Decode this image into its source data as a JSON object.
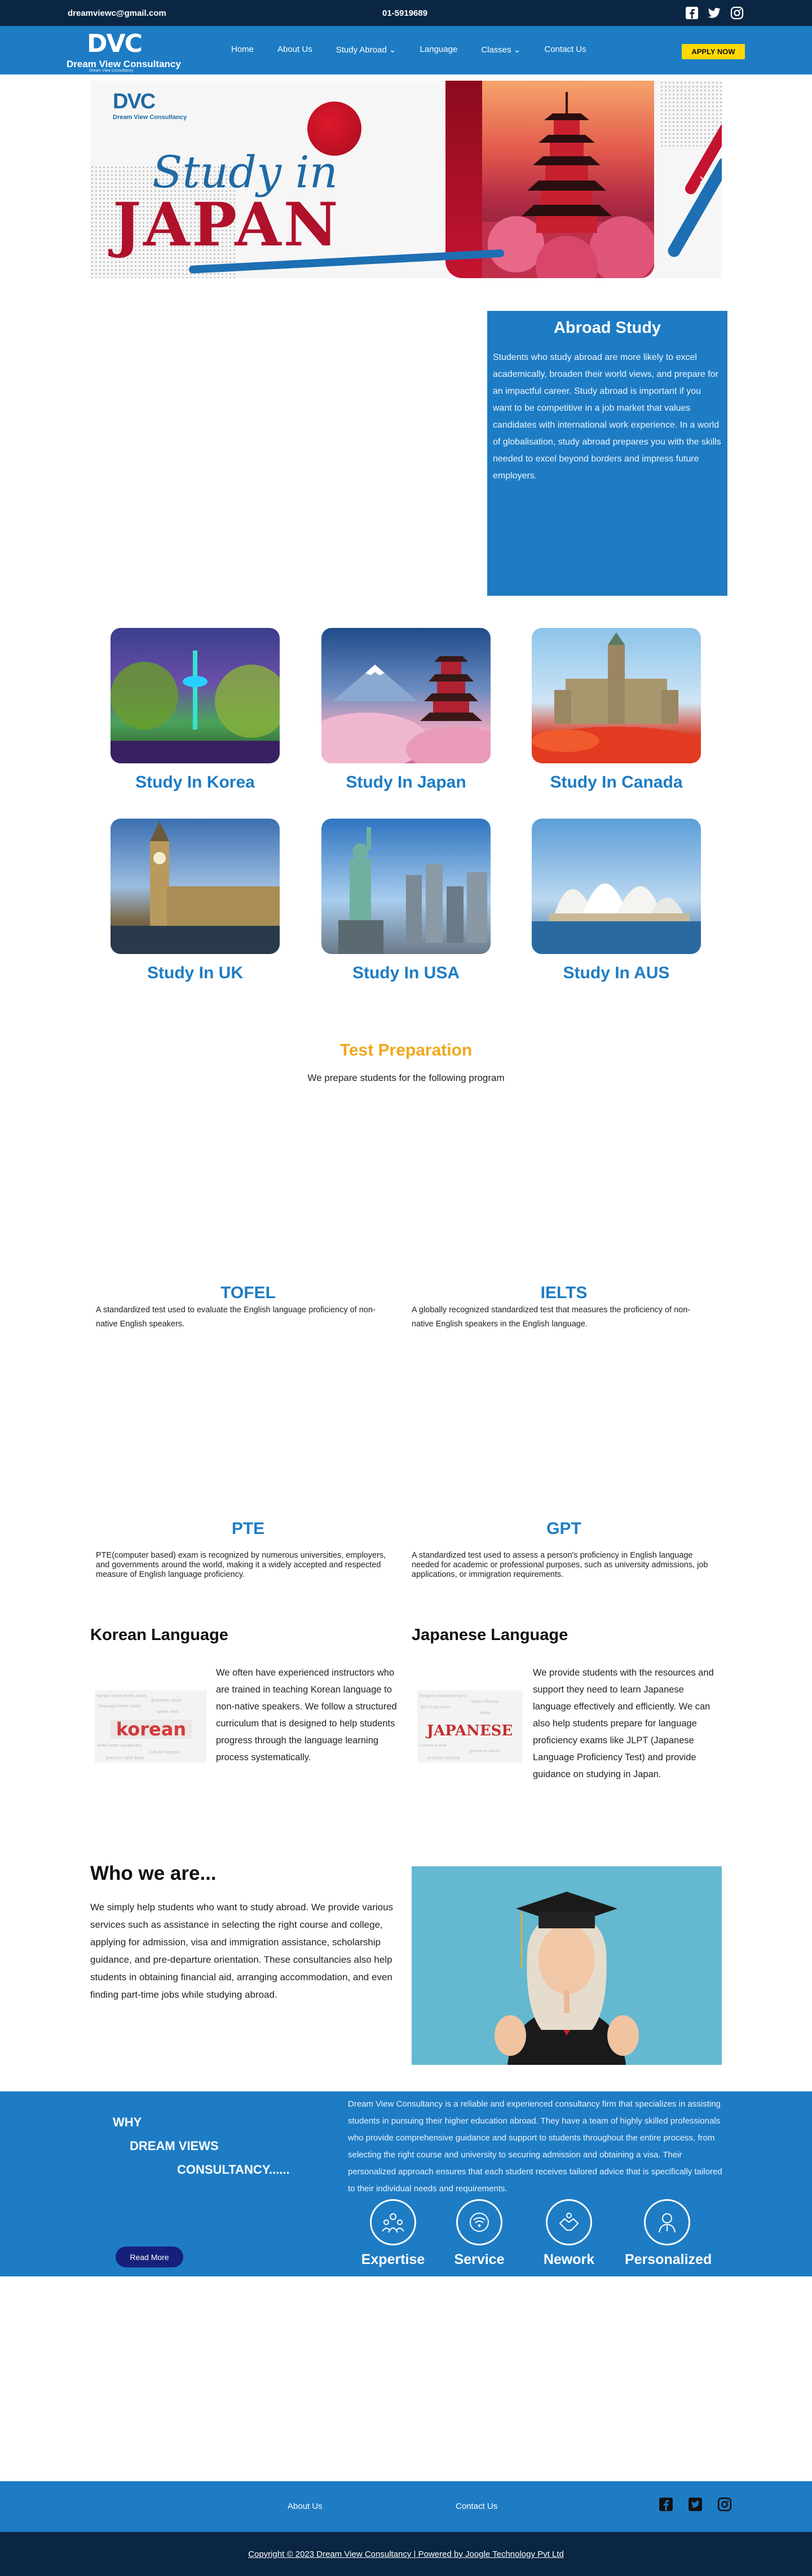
{
  "topbar": {
    "email": "dreamviewc@gmail.com",
    "phone": "01-5919689",
    "social": [
      "facebook-icon",
      "twitter-icon",
      "instagram-icon"
    ]
  },
  "brand": {
    "logo_mark": "DVC",
    "name": "Dream View Consultancy",
    "tagline": "Dream View Consultancy"
  },
  "nav": {
    "items": [
      {
        "label": "Home"
      },
      {
        "label": "About Us"
      },
      {
        "label": "Study Abroad"
      },
      {
        "label": "Language"
      },
      {
        "label": "Classes"
      },
      {
        "label": "Contact Us"
      }
    ],
    "apply_label": "APPLY NOW"
  },
  "banner": {
    "logo_mark": "DVC",
    "logo_name": "Dream View Consultancy",
    "line1": "Study in",
    "line2": "JAPAN"
  },
  "abroad": {
    "title": "Abroad Study",
    "text": "Students who study abroad are more likely to excel academically, broaden their world views, and prepare for an impactful career. Study abroad is important if you want to be competitive in a job market that values candidates with international work experience. In a world of globalisation, study abroad prepares you with the skills needed to excel beyond borders and impress future employers."
  },
  "destinations": [
    {
      "label": "Study In Korea"
    },
    {
      "label": "Study In Japan"
    },
    {
      "label": "Study In Canada"
    },
    {
      "label": "Study In UK"
    },
    {
      "label": "Study In USA"
    },
    {
      "label": "Study In AUS"
    }
  ],
  "test_prep": {
    "title": "Test Preparation",
    "subtitle": "We prepare students for the following program",
    "exams": [
      {
        "name": "TOFEL",
        "desc": "A standardized test used to evaluate the English language proficiency of non-native English speakers."
      },
      {
        "name": "IELTS",
        "desc": "A globally recognized standardized test that measures the proficiency of non-native English speakers in the English language."
      },
      {
        "name": "PTE",
        "desc": "PTE(computer based) exam is recognized by numerous universities, employers, and governments around the world, making it a widely accepted and respected measure of English language proficiency."
      },
      {
        "name": "GPT",
        "desc": "A standardized test used to assess a person's proficiency in English language needed for academic or professional purposes, such as university admissions, job applications, or immigration requirements."
      }
    ]
  },
  "languages": {
    "korean": {
      "title": "Korean Language",
      "img_text": "korean",
      "text": "We often have experienced instructors who are trained in teaching Korean language to non-native speakers. We follow a structured curriculum that is designed to help students progress through the language learning process systematically."
    },
    "japanese": {
      "title": "Japanese Language",
      "img_text": "JAPANESE",
      "text": "We provide students with the resources and support they need to learn Japanese language effectively and efficiently. We can also help students prepare for language proficiency exams like JLPT (Japanese Language Proficiency Test) and provide guidance on studying in Japan."
    }
  },
  "who": {
    "title": "Who we are...",
    "text": "We simply  help students who want to study abroad. We provide various services such as assistance in selecting the right course and college, applying for admission, visa and immigration assistance, scholarship guidance, and pre-departure orientation. These consultancies also help students in obtaining financial aid, arranging accommodation, and even finding part-time jobs while studying abroad."
  },
  "why": {
    "line1": "WHY",
    "line2": "DREAM VIEWS",
    "line3": "CONSULTANCY......",
    "text": "Dream View Consultancy is a reliable and experienced consultancy firm that specializes in assisting students in pursuing their higher education abroad. They have a team of highly skilled professionals who provide comprehensive guidance and support to students throughout the entire process, from selecting the right course and university to securing admission and obtaining a visa. Their personalized approach ensures that each student receives tailored advice that is specifically tailored to their individual needs and requirements.",
    "read_more": "Read More",
    "features": [
      {
        "label": "Expertise",
        "icon": "team-icon"
      },
      {
        "label": "Service",
        "icon": "service-icon"
      },
      {
        "label": "Nework",
        "icon": "network-icon"
      },
      {
        "label": "Personalized",
        "icon": "person-icon"
      }
    ]
  },
  "footer": {
    "link1": "About Us",
    "link2": "Contact Us",
    "copyright": "Copyright © 2023 Dream View Consultancy | Powered by Joogle Technology Pvt Ltd"
  },
  "colors": {
    "primary": "#1e7cc4",
    "dark": "#0b2642",
    "accent_yellow": "#ffd900",
    "heading_orange": "#f0a81c"
  }
}
